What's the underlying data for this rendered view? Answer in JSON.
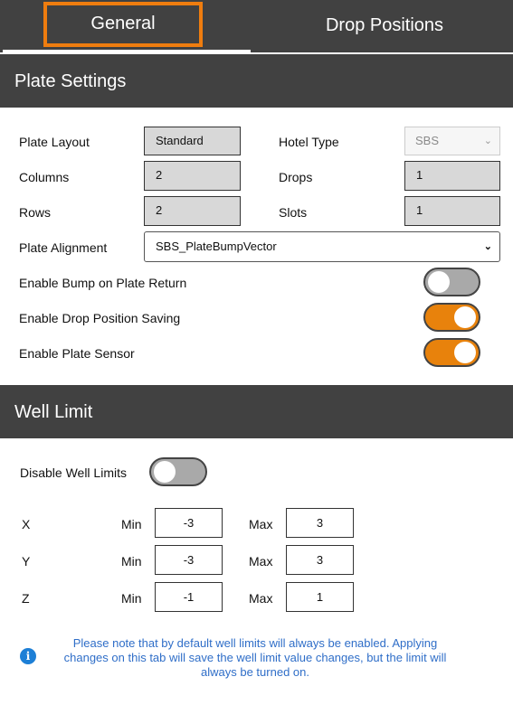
{
  "tabs": [
    {
      "label": "General",
      "active": true
    },
    {
      "label": "Drop Positions",
      "active": false
    }
  ],
  "plate_settings": {
    "title": "Plate Settings",
    "plate_layout": {
      "label": "Plate Layout",
      "value": "Standard"
    },
    "hotel_type": {
      "label": "Hotel Type",
      "value": "SBS",
      "icon": "chevron-down-icon"
    },
    "columns": {
      "label": "Columns",
      "value": "2"
    },
    "drops": {
      "label": "Drops",
      "value": "1"
    },
    "rows": {
      "label": "Rows",
      "value": "2"
    },
    "slots": {
      "label": "Slots",
      "value": "1"
    },
    "plate_alignment": {
      "label": "Plate Alignment",
      "value": "SBS_PlateBumpVector",
      "icon": "chevron-down-icon"
    },
    "toggles": [
      {
        "label": "Enable Bump on Plate Return",
        "on": false
      },
      {
        "label": "Enable Drop Position Saving",
        "on": true
      },
      {
        "label": "Enable Plate Sensor",
        "on": true
      }
    ]
  },
  "well_limit": {
    "title": "Well Limit",
    "disable_label": "Disable Well Limits",
    "disable_on": false,
    "min_label": "Min",
    "max_label": "Max",
    "axes": [
      {
        "axis": "X",
        "min": "-3",
        "max": "3"
      },
      {
        "axis": "Y",
        "min": "-3",
        "max": "3"
      },
      {
        "axis": "Z",
        "min": "-1",
        "max": "1"
      }
    ],
    "note": "Please note that by default well limits will always be enabled. Applying changes on this tab will save the well limit value changes, but the limit will always be turned on.",
    "note_icon": "info-icon"
  },
  "colors": {
    "accent": "#e8820c",
    "header": "#414141",
    "note": "#2f6ec8"
  }
}
